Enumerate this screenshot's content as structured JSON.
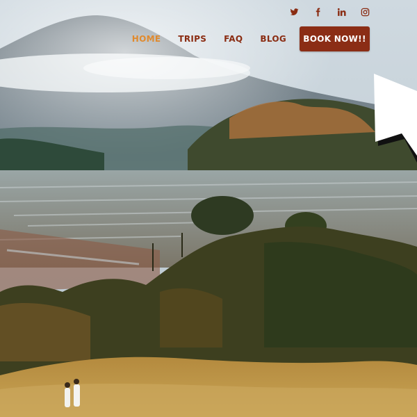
{
  "social": [
    {
      "name": "twitter",
      "icon": "twitter-icon"
    },
    {
      "name": "facebook",
      "icon": "facebook-icon"
    },
    {
      "name": "linkedin",
      "icon": "linkedin-icon"
    },
    {
      "name": "instagram",
      "icon": "instagram-icon"
    }
  ],
  "nav": {
    "items": [
      {
        "label": "HOME",
        "active": true
      },
      {
        "label": "TRIPS",
        "active": false
      },
      {
        "label": "FAQ",
        "active": false
      },
      {
        "label": "BLOG",
        "active": false
      }
    ],
    "cta_label": "BOOK NOW!!"
  },
  "colors": {
    "nav_text": "#8a2c12",
    "nav_active": "#e08a2e",
    "cta_background": "#8b2d15",
    "cta_text": "#ffffff"
  }
}
